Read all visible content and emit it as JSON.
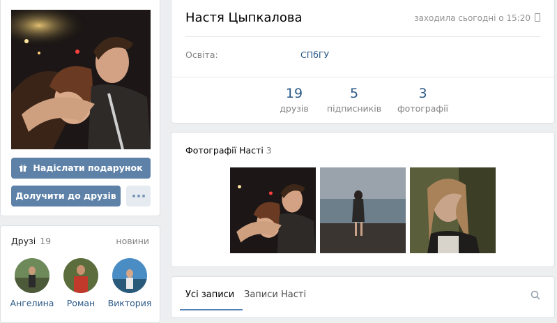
{
  "profile": {
    "name": "Настя Цыпкалова",
    "last_seen": "заходила сьогодні о 15:20",
    "education_label": "Освіта:",
    "education_value": "СПбГУ",
    "counters": [
      {
        "value": "19",
        "label": "друзів"
      },
      {
        "value": "5",
        "label": "підписників"
      },
      {
        "value": "3",
        "label": "фотографії"
      }
    ]
  },
  "actions": {
    "gift_label": "Надіслати подарунок",
    "add_friend_label": "Долучити до друзів",
    "more_icon": "more-dots-icon"
  },
  "friends": {
    "title": "Друзі",
    "count": "19",
    "news": "новини",
    "items": [
      {
        "name": "Ангелина"
      },
      {
        "name": "Роман"
      },
      {
        "name": "Виктория"
      }
    ]
  },
  "photos": {
    "title": "Фотографії Насті",
    "count": "3"
  },
  "wall": {
    "tab_all": "Усі записи",
    "tab_own": "Записи Насті",
    "search_icon": "search-icon"
  },
  "colors": {
    "accent": "#5e81a8",
    "link": "#2a5885",
    "background": "#edeef0"
  }
}
